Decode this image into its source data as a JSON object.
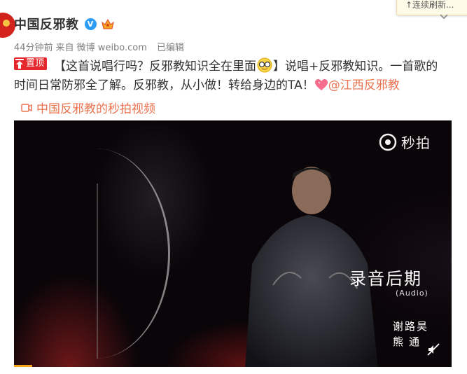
{
  "popup": {
    "text": "↑连续刷新..."
  },
  "post": {
    "author": "中国反邪教",
    "verified_mark": "V",
    "meta": {
      "time": "44分钟前",
      "from": "来自 微博 weibo.com",
      "edited": "已编辑"
    },
    "pin_label": "置顶",
    "text_part1": "【这首说唱行吗？反邪教知识全在里面",
    "text_part2": "】说唱+反邪教知识。一首歌的时间日常防邪全了解。反邪教，从小做！转给身边的TA！",
    "mention": "@江西反邪教",
    "video_link": "中国反邪教的秒拍视频"
  },
  "video": {
    "watermark": "秒拍",
    "caption_title": "录音后期",
    "caption_sub": "(Audio)",
    "credit_line1": "谢路昊",
    "credit_line2": "熊通",
    "progress_fraction": 0.04
  },
  "colors": {
    "accent": "#eb7350",
    "pin": "#e6262d",
    "verified": "#2d9cf4",
    "progress": "#f7a41d"
  },
  "icons": [
    "chevron-down-icon",
    "pin-icon",
    "emoji-sunglasses-icon",
    "heart-emoji-icon",
    "video-camera-icon",
    "miaopai-logo-icon",
    "mute-icon",
    "member-crown-icon"
  ]
}
